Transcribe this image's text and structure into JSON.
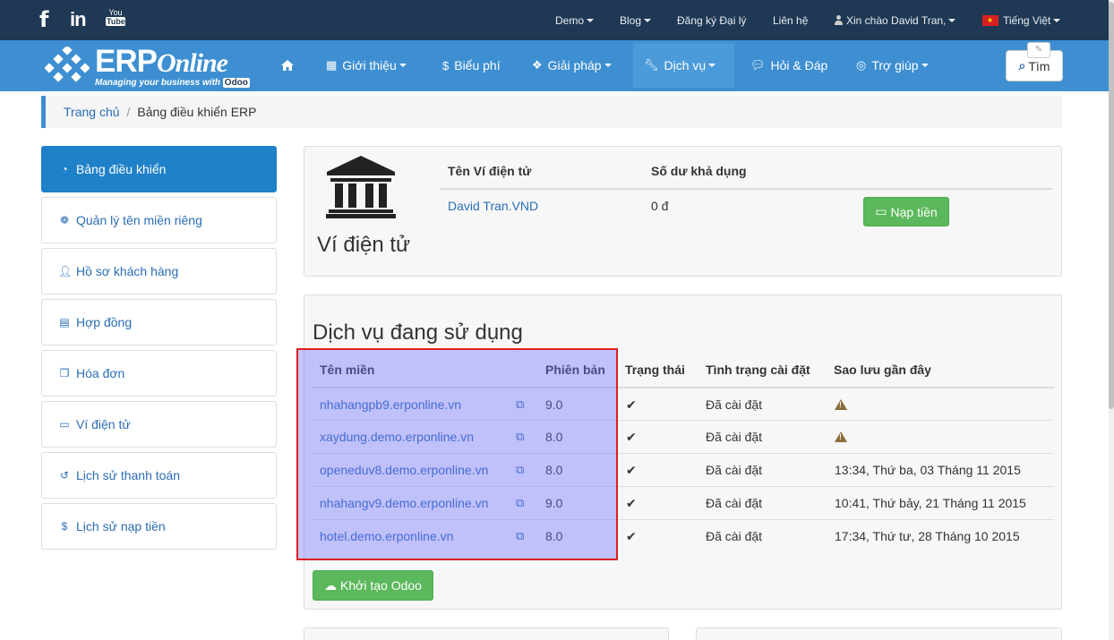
{
  "topbar": {
    "social": [
      "facebook-icon",
      "linkedin-icon",
      "youtube-icon"
    ],
    "youtube_top": "You",
    "youtube_bottom": "Tube",
    "links": {
      "demo": "Demo",
      "blog": "Blog",
      "agent": "Đăng ký Đại lý",
      "contact": "Liên hệ",
      "greeting": "Xin chào David Tran,",
      "language": "Tiếng Việt"
    }
  },
  "navbar": {
    "logo_erp": "ERP",
    "logo_online": "Online",
    "logo_tag": "Managing your business with",
    "logo_odoo": "Odoo",
    "items": {
      "intro": "Giới thiệu",
      "pricing": "Biểu phí",
      "solutions": "Giải pháp",
      "services": "Dịch vụ",
      "qa": "Hỏi & Đáp",
      "help": "Trợ giúp"
    },
    "search_label": "Tìm"
  },
  "breadcrumb": {
    "home": "Trang chủ",
    "separator": "/",
    "current": "Bảng điều khiển ERP"
  },
  "sidebar": {
    "items": [
      {
        "label": "Bảng điều khiển",
        "icon": "dashboard-icon"
      },
      {
        "label": "Quản lý tên miền riêng",
        "icon": "paw-icon"
      },
      {
        "label": "Hồ sơ khách hàng",
        "icon": "user-icon"
      },
      {
        "label": "Hợp đồng",
        "icon": "file-icon"
      },
      {
        "label": "Hóa đơn",
        "icon": "copy-icon"
      },
      {
        "label": "Ví điện tử",
        "icon": "credit-card-icon"
      },
      {
        "label": "Lịch sử thanh toán",
        "icon": "history-icon"
      },
      {
        "label": "Lịch sử nạp tiền",
        "icon": "dollar-icon"
      }
    ]
  },
  "wallet": {
    "title": "Ví điện tử",
    "col_name": "Tên Ví điện tử",
    "col_balance": "Số dư khả dụng",
    "name": "David Tran.VND",
    "balance": "0 đ",
    "topup_label": "Nạp tiền"
  },
  "services": {
    "title": "Dịch vụ đang sử dụng",
    "headers": {
      "domain": "Tên miền",
      "version": "Phiên bản",
      "status": "Trạng thái",
      "install": "Tình trạng cài đặt",
      "backup": "Sao lưu gần đây"
    },
    "rows": [
      {
        "domain": "nhahangpb9.erponline.vn",
        "version": "9.0",
        "install": "Đã cài đặt",
        "backup": ""
      },
      {
        "domain": "xaydung.demo.erponline.vn",
        "version": "8.0",
        "install": "Đã cài đặt",
        "backup": ""
      },
      {
        "domain": "openeduv8.demo.erponline.vn",
        "version": "8.0",
        "install": "Đã cài đặt",
        "backup": "13:34, Thứ ba, 03 Tháng 11 2015"
      },
      {
        "domain": "nhahangv9.demo.erponline.vn",
        "version": "9.0",
        "install": "Đã cài đặt",
        "backup": "10:41, Thứ bảy, 21 Tháng 11 2015"
      },
      {
        "domain": "hotel.demo.erponline.vn",
        "version": "8.0",
        "install": "Đã cài đặt",
        "backup": "17:34, Thứ tư, 28 Tháng 10 2015"
      }
    ],
    "create_label": "Khởi tạo Odoo"
  },
  "colors": {
    "topbar": "#1f3853",
    "navbar": "#3d8fd1",
    "active_side": "#1f81c8",
    "button_green": "#5cb85c",
    "highlight_border": "#e02020"
  }
}
